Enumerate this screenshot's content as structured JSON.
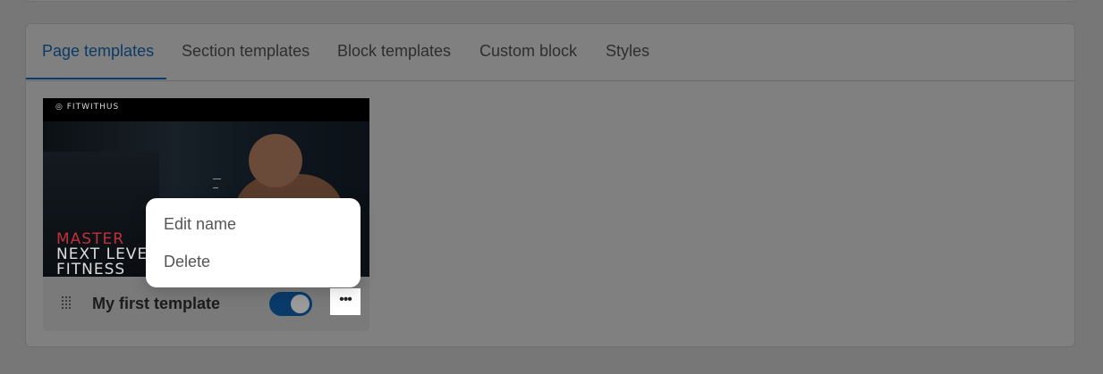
{
  "tabs": [
    {
      "label": "Page templates",
      "active": true
    },
    {
      "label": "Section templates"
    },
    {
      "label": "Block templates"
    },
    {
      "label": "Custom block"
    },
    {
      "label": "Styles"
    }
  ],
  "template_card": {
    "title": "My first template",
    "enabled": true,
    "preview": {
      "logo_text": "FITWITHUS",
      "hero_line1": "MASTER",
      "hero_line2": "NEXT LEVEL",
      "hero_line3": "FITNESS"
    },
    "more_label": "•••"
  },
  "context_menu": {
    "items": [
      "Edit name",
      "Delete"
    ]
  },
  "colors": {
    "accent": "#0a3a66",
    "overlay_bg": "#777777",
    "menu_bg": "#ffffff"
  },
  "icons": [
    "drag-handle-icon",
    "more-options-icon",
    "logo-icon"
  ]
}
